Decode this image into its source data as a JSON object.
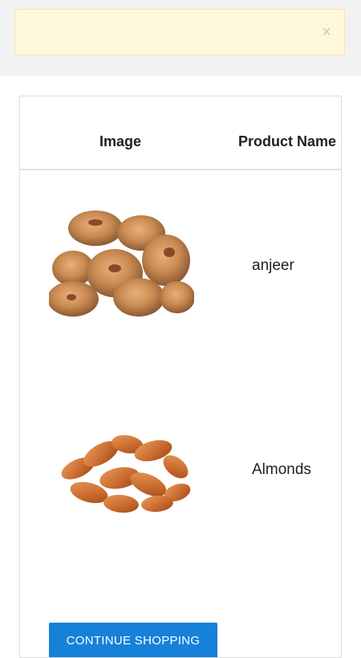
{
  "alert": {
    "message": "",
    "close_icon": "×"
  },
  "table": {
    "headers": {
      "image": "Image",
      "product_name": "Product Name"
    },
    "rows": [
      {
        "product_name": "anjeer",
        "image_icon": "dried-figs-image"
      },
      {
        "product_name": "Almonds",
        "image_icon": "almonds-image"
      }
    ]
  },
  "actions": {
    "continue_label": "CONTINUE SHOPPING"
  },
  "colors": {
    "alert_bg": "#fef7d9",
    "button_bg": "#1681d9"
  }
}
